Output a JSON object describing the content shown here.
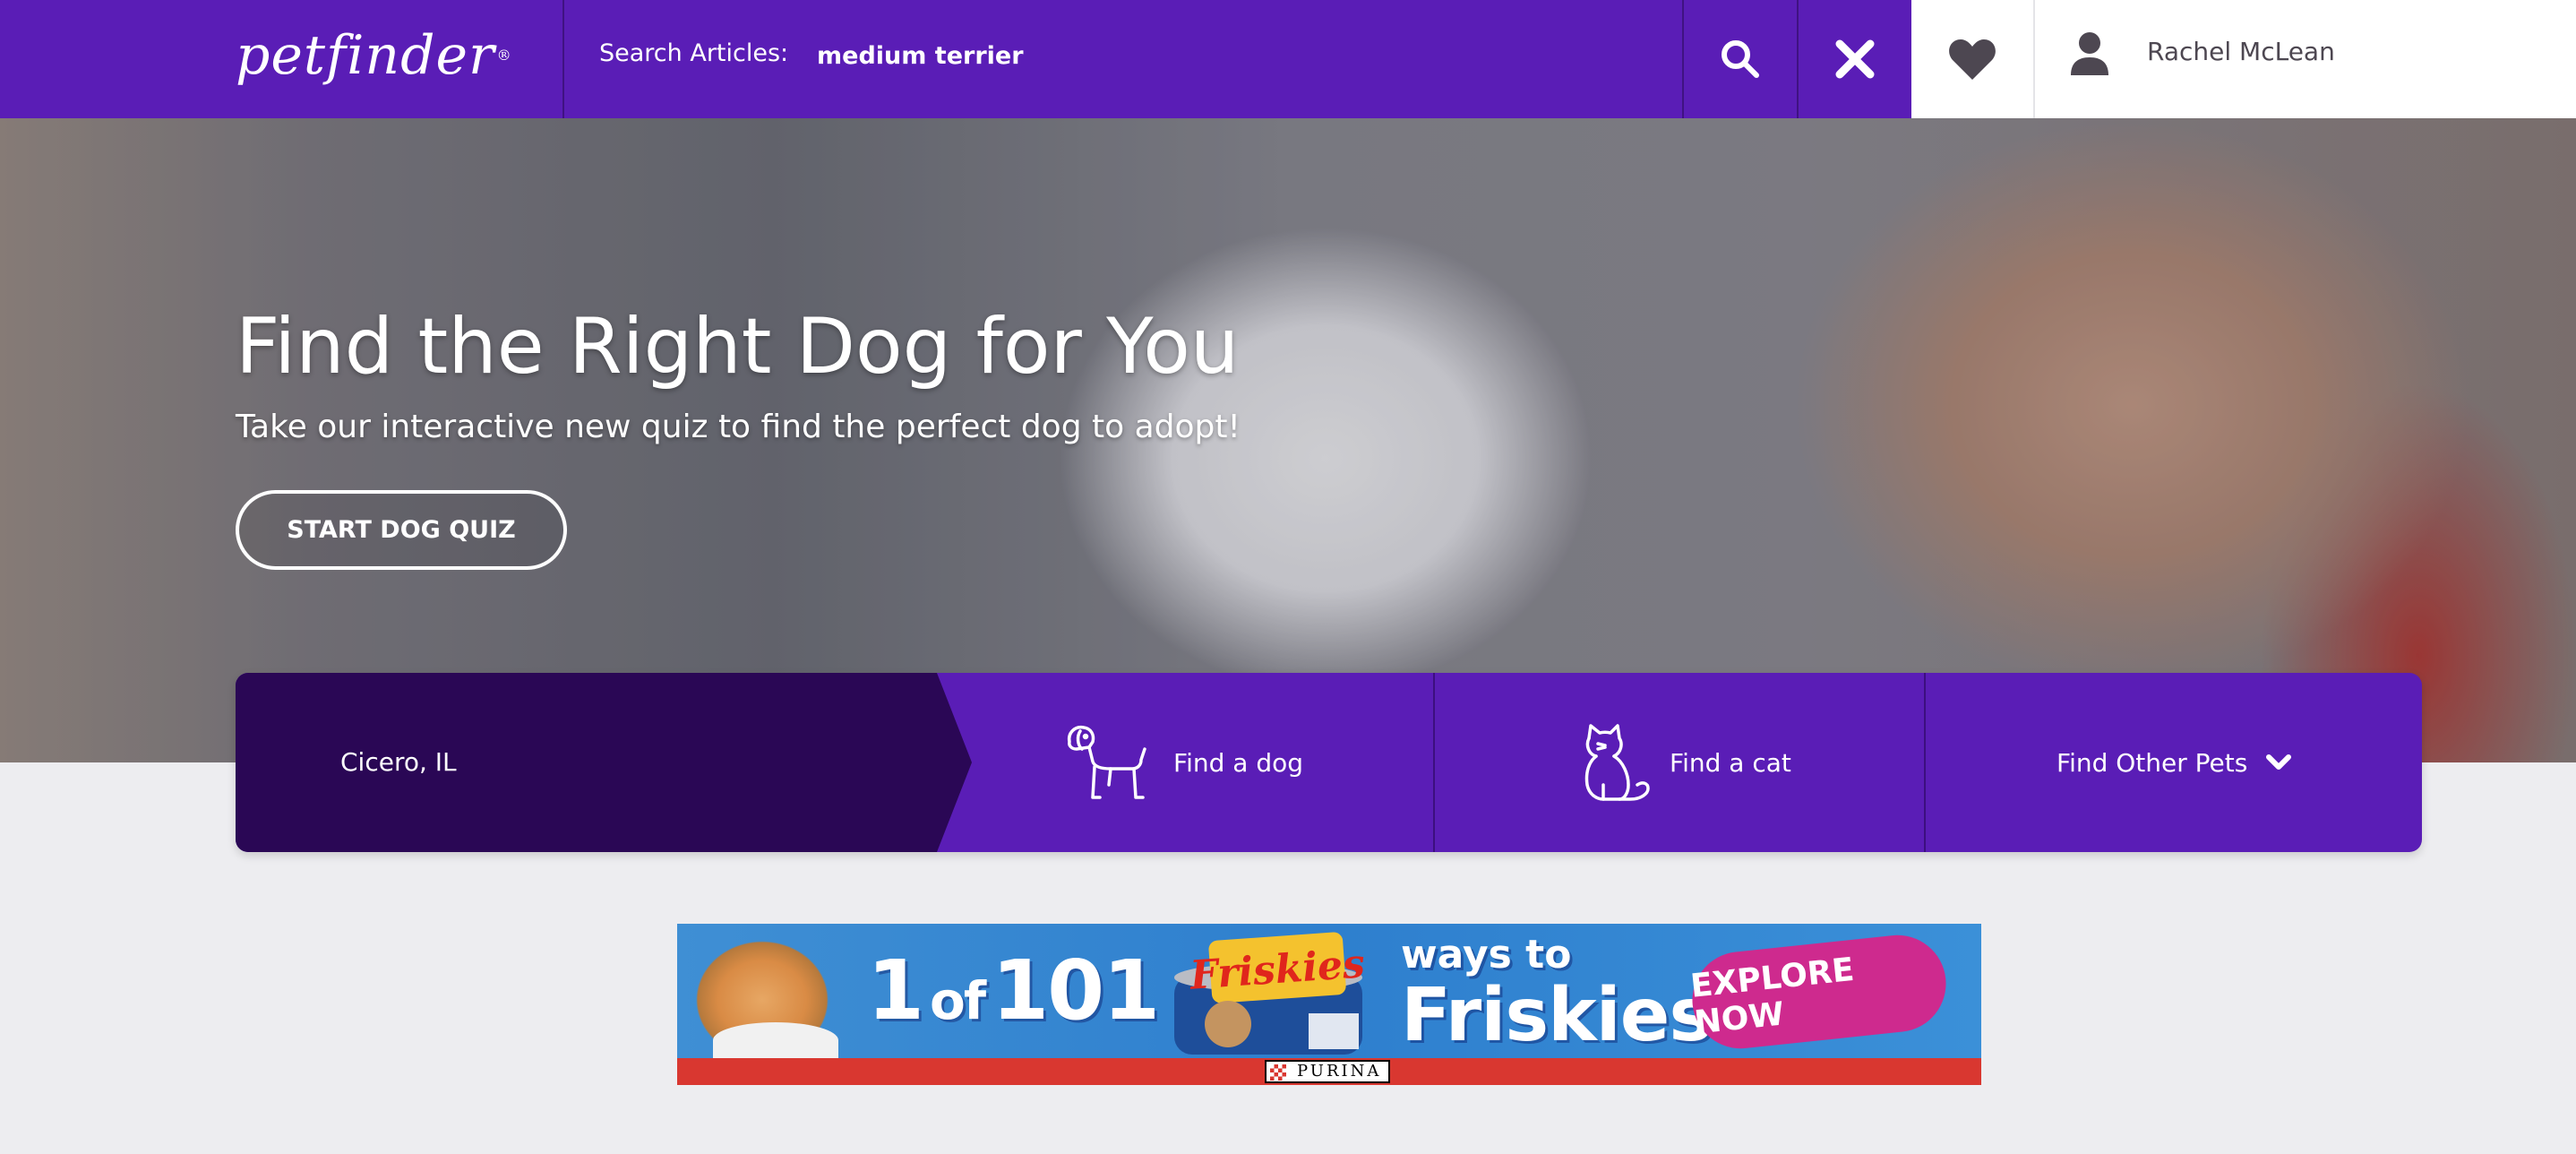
{
  "header": {
    "logo_text": "petfinder",
    "logo_mark": "®",
    "search_label": "Search Articles:",
    "search_value": "medium terrier",
    "user_name": "Rachel McLean",
    "colors": {
      "primary": "#5A1DB6",
      "dark": "#2A0755",
      "white": "#FFFFFF"
    },
    "icons": [
      "search-icon",
      "close-icon",
      "heart-icon",
      "user-icon"
    ]
  },
  "hero": {
    "title": "Find the Right Dog for You",
    "subtitle": "Take our interactive new quiz to find the perfect dog to adopt!",
    "cta_label": "START DOG QUIZ"
  },
  "finder": {
    "location": "Cicero, IL",
    "find_dog": "Find a dog",
    "find_cat": "Find a cat",
    "find_other": "Find Other Pets",
    "icons": [
      "dog-icon",
      "cat-icon",
      "chevron-down-icon"
    ]
  },
  "ad": {
    "headline_1": "1",
    "headline_of": "of",
    "headline_2": "101",
    "brand": "Friskies",
    "ways_to": "ways to",
    "ways_brand": "Friskies",
    "cta": "EXPLORE NOW",
    "sponsor": "PURINA",
    "colors": {
      "bg": "#3F8FD4",
      "cta": "#CE2A8E",
      "strip": "#D93730"
    }
  }
}
